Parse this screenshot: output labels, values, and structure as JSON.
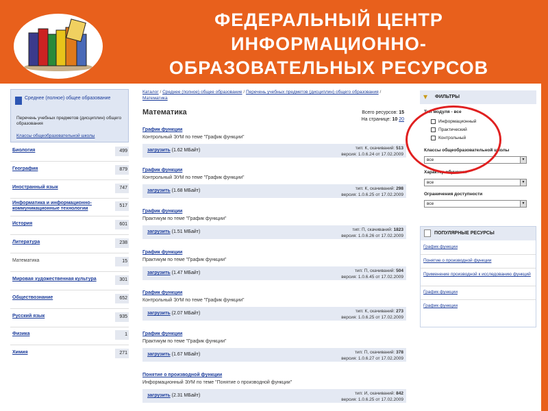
{
  "title": [
    "ФЕДЕРАЛЬНЫЙ ЦЕНТР",
    "ИНФОРМАЦИОННО-",
    "ОБРАЗОВАТЕЛЬНЫХ РЕСУРСОВ"
  ],
  "sidebar": {
    "section_title": "Среднее (полное) общее образование",
    "subtitle": "Перечень учебных предметов (дисциплин) общего образования",
    "school_link": "Классы общеобразовательной школы",
    "subjects": [
      {
        "name": "Биология",
        "count": "499",
        "current": false
      },
      {
        "name": "География",
        "count": "879",
        "current": false
      },
      {
        "name": "Иностранный язык",
        "count": "747",
        "current": false
      },
      {
        "name": "Информатика и информационно-коммуникационные технологии",
        "count": "517",
        "current": false
      },
      {
        "name": "История",
        "count": "601",
        "current": false
      },
      {
        "name": "Литература",
        "count": "238",
        "current": false
      },
      {
        "name": "Математика",
        "count": "15",
        "current": true
      },
      {
        "name": "Мировая художественная культура",
        "count": "301",
        "current": false
      },
      {
        "name": "Обществознание",
        "count": "652",
        "current": false
      },
      {
        "name": "Русский язык",
        "count": "935",
        "current": false
      },
      {
        "name": "Физика",
        "count": "1",
        "current": false
      },
      {
        "name": "Химия",
        "count": "271",
        "current": false
      }
    ]
  },
  "breadcrumb": {
    "items": [
      "Каталог",
      "Среднее (полное) общее образование",
      "Перечень учебных предметов (дисциплин) общего образования",
      "Математика"
    ],
    "separator": "/"
  },
  "main": {
    "title": "Математика",
    "total_label": "Всего ресурсов:",
    "total_value": "15",
    "per_page_label": "На странице:",
    "per_page_value": "10",
    "per_page_alt": "20",
    "download_label": "загрузить",
    "resources": [
      {
        "name": "График функции",
        "desc": "Контрольный ЭУМ по теме \"График функции\"",
        "size": "(1.62 МБайт)",
        "type": "тип: К, скачиваний:",
        "downloads": "513",
        "version": "версия: 1.0.6.24 от 17.02.2009"
      },
      {
        "name": "График функции",
        "desc": "Контрольный ЭУМ по теме \"График функции\"",
        "size": "(1.68 МБайт)",
        "type": "тип: К, скачиваний:",
        "downloads": "298",
        "version": "версия: 1.0.6.25 от 17.02.2009"
      },
      {
        "name": "График функции",
        "desc": "Практикум по теме \"График функции\"",
        "size": "(1.51 МБайт)",
        "type": "тип: П, скачиваний:",
        "downloads": "1823",
        "version": "версия: 1.0.6.26 от 17.02.2009"
      },
      {
        "name": "График функции",
        "desc": "Практикум по теме \"График функции\"",
        "size": "(1.47 МБайт)",
        "type": "тип: П, скачиваний:",
        "downloads": "504",
        "version": "версия: 1.0.6.45 от 17.02.2009"
      },
      {
        "name": "График функции",
        "desc": "Контрольный ЭУМ по теме \"График функции\"",
        "size": "(2.07 МБайт)",
        "type": "тип: К, скачиваний:",
        "downloads": "273",
        "version": "версия: 1.0.6.25 от 17.02.2009"
      },
      {
        "name": "График функции",
        "desc": "Практикум по теме \"График функции\"",
        "size": "(1.67 МБайт)",
        "type": "тип: П, скачиваний:",
        "downloads": "378",
        "version": "версия: 1.0.6.27 от 17.02.2009"
      },
      {
        "name": "Понятие о производной функции",
        "desc": "Информационный ЭУМ по теме \"Понятие о производной функции\"",
        "size": "(2.31 МБайт)",
        "type": "тип: И, скачиваний:",
        "downloads": "842",
        "version": "версия: 1.0.6.25 от 17.02.2009"
      }
    ]
  },
  "filters": {
    "header": "ФИЛЬТРЫ",
    "module_type_label": "Тип модуля - все",
    "module_types": [
      "Информационный",
      "Практический",
      "Контрольный"
    ],
    "school_classes_label": "Классы общеобразовательной школы",
    "school_classes_value": "все",
    "learning_type_label": "Характер обучения",
    "learning_type_value": "все",
    "access_label": "Ограничения доступности",
    "access_value": "все"
  },
  "popular": {
    "header": "ПОПУЛЯРНЫЕ РЕСУРСЫ",
    "items": [
      "График функции",
      "Понятие о производной функции",
      "Применение производной к исследованию функций",
      "График функции",
      "График функции"
    ]
  },
  "colors": {
    "banner": "#e8601c",
    "link": "#1a3b9a",
    "bar": "#e4e9f3",
    "highlight": "#e02020"
  }
}
